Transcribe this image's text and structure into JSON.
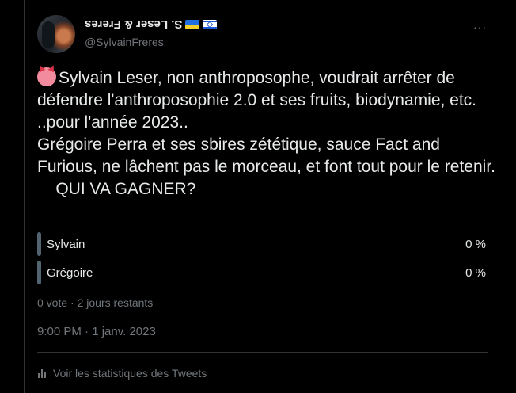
{
  "tweet": {
    "author_name": "S. Leser & Freres",
    "handle": "@SylvainFreres",
    "more_label": "···",
    "text": "Sylvain Leser, non anthroposophe, voudrait arrêter de défendre l'anthroposophie 2.0 et ses fruits, biodynamie, etc. ..pour l'année 2023..\nGrégoire Perra et ses sbires zététique, sauce Fact and Furious, ne lâchent pas le morceau, et font tout pour le retenir.\n    QUI VA GAGNER?",
    "emoji": "devil-face-icon",
    "timestamp": "9:00 PM · 1 janv. 2023",
    "stats_label": "Voir les statistiques des Tweets"
  },
  "poll": {
    "options": [
      {
        "label": "Sylvain",
        "percent": "0 %",
        "fraction": 0
      },
      {
        "label": "Grégoire",
        "percent": "0 %",
        "fraction": 0
      }
    ],
    "meta": "0 vote · 2 jours restants"
  },
  "colors": {
    "background": "#000000",
    "text": "#e7e9ea",
    "secondary": "#71767b",
    "poll_bar": "#536471"
  }
}
